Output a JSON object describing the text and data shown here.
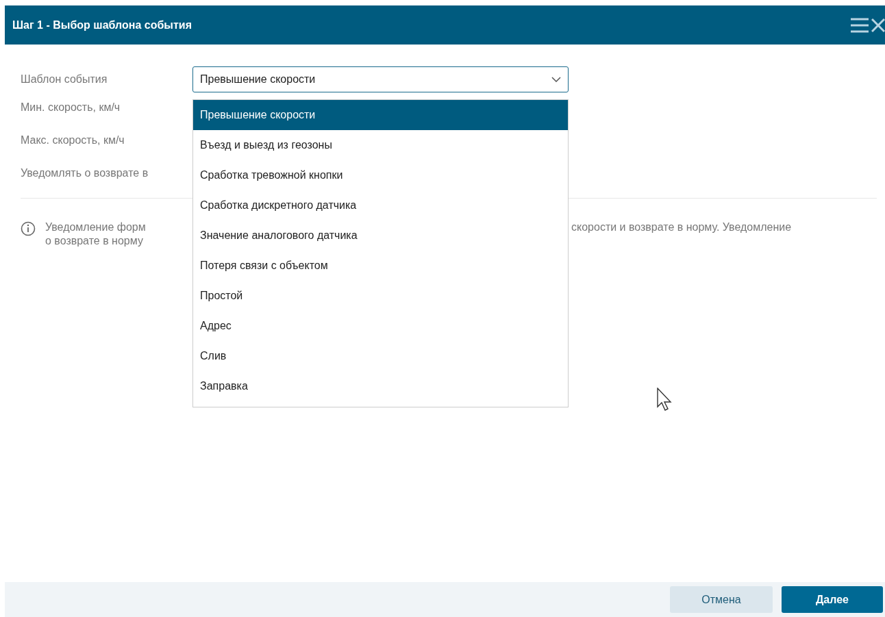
{
  "window": {
    "title": "Шаг 1 - Выбор шаблона события"
  },
  "form": {
    "template_label": "Шаблон события",
    "template_value": "Превышение скорости",
    "labels": [
      "Мин. скорость, км/ч",
      "Макс. скорость, км/ч",
      "Уведомлять о возврате в"
    ]
  },
  "dropdown": {
    "options": [
      {
        "label": "Превышение скорости",
        "selected": true
      },
      {
        "label": "Въезд и выезд из геозоны",
        "selected": false
      },
      {
        "label": "Сработка тревожной кнопки",
        "selected": false
      },
      {
        "label": "Сработка дискретного датчика",
        "selected": false
      },
      {
        "label": "Значение аналогового датчика",
        "selected": false
      },
      {
        "label": "Потеря связи с объектом",
        "selected": false
      },
      {
        "label": "Простой",
        "selected": false
      },
      {
        "label": "Адрес",
        "selected": false
      },
      {
        "label": "Слив",
        "selected": false
      },
      {
        "label": "Заправка",
        "selected": false
      }
    ]
  },
  "info": {
    "line_1_left": "Уведомление форм",
    "line_1_right": "скорости и возврате в норму. Уведомление",
    "line_2_left": "о возврате в норму"
  },
  "buttons": {
    "cancel": "Отмена",
    "next": "Далее"
  }
}
